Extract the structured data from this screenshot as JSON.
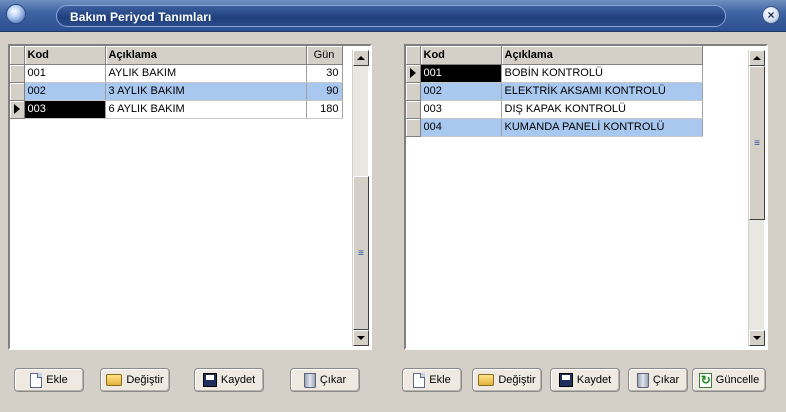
{
  "window": {
    "title": "Bakım Periyod Tanımları",
    "close_label": "×"
  },
  "left_grid": {
    "columns": {
      "kod": "Kod",
      "aciklama": "Açıklama",
      "gun": "Gün"
    },
    "rows": [
      {
        "kod": "001",
        "aciklama": "AYLIK BAKIM",
        "gun": "30"
      },
      {
        "kod": "002",
        "aciklama": "3 AYLIK BAKIM",
        "gun": "90"
      },
      {
        "kod": "003",
        "aciklama": "6 AYLIK BAKIM",
        "gun": "180"
      }
    ]
  },
  "right_grid": {
    "columns": {
      "kod": "Kod",
      "aciklama": "Açıklama"
    },
    "rows": [
      {
        "kod": "001",
        "aciklama": "BOBİN KONTROLÜ"
      },
      {
        "kod": "002",
        "aciklama": "ELEKTRİK AKSAMI KONTROLÜ"
      },
      {
        "kod": "003",
        "aciklama": "DIŞ KAPAK KONTROLÜ"
      },
      {
        "kod": "004",
        "aciklama": "KUMANDA PANELİ KONTROLÜ"
      }
    ]
  },
  "left_buttons": {
    "ekle": "Ekle",
    "degistir": "Değiştir",
    "kaydet": "Kaydet",
    "cikar": "Çıkar"
  },
  "right_buttons": {
    "ekle": "Ekle",
    "degistir": "Değiştir",
    "kaydet": "Kaydet",
    "cikar": "Çıkar",
    "guncelle": "Güncelle"
  },
  "colors": {
    "highlight_row": "#a9c8ef",
    "selected_cell": "#000000",
    "titlebar": "#2b4f8f"
  }
}
